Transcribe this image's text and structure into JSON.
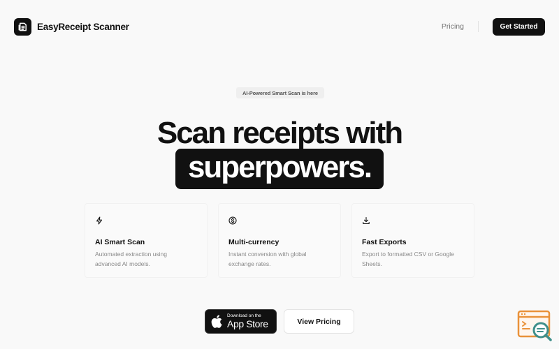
{
  "header": {
    "brand_name": "EasyReceipt Scanner",
    "nav_pricing": "Pricing",
    "cta_label": "Get Started"
  },
  "hero": {
    "badge": "AI-Powered Smart Scan is here",
    "line1": "Scan receipts with",
    "line2": "superpowers."
  },
  "features": [
    {
      "icon": "lightning-icon",
      "title": "AI Smart Scan",
      "desc_line1": "Automated extraction using",
      "desc_line2": "advanced AI models."
    },
    {
      "icon": "dollar-coin-icon",
      "title": "Multi-currency",
      "desc_line1": "Instant conversion with global",
      "desc_line2": "exchange rates."
    },
    {
      "icon": "download-icon",
      "title": "Fast Exports",
      "desc_line1": "Export to formatted CSV or Google",
      "desc_line2": "Sheets."
    }
  ],
  "cta": {
    "appstore_small": "Download on the",
    "appstore_big": "App Store",
    "view_pricing": "View Pricing"
  },
  "colors": {
    "accent": "#111111",
    "background": "#f9f9f9",
    "widget_orange": "#e9923a",
    "widget_teal": "#3f8f8a"
  }
}
